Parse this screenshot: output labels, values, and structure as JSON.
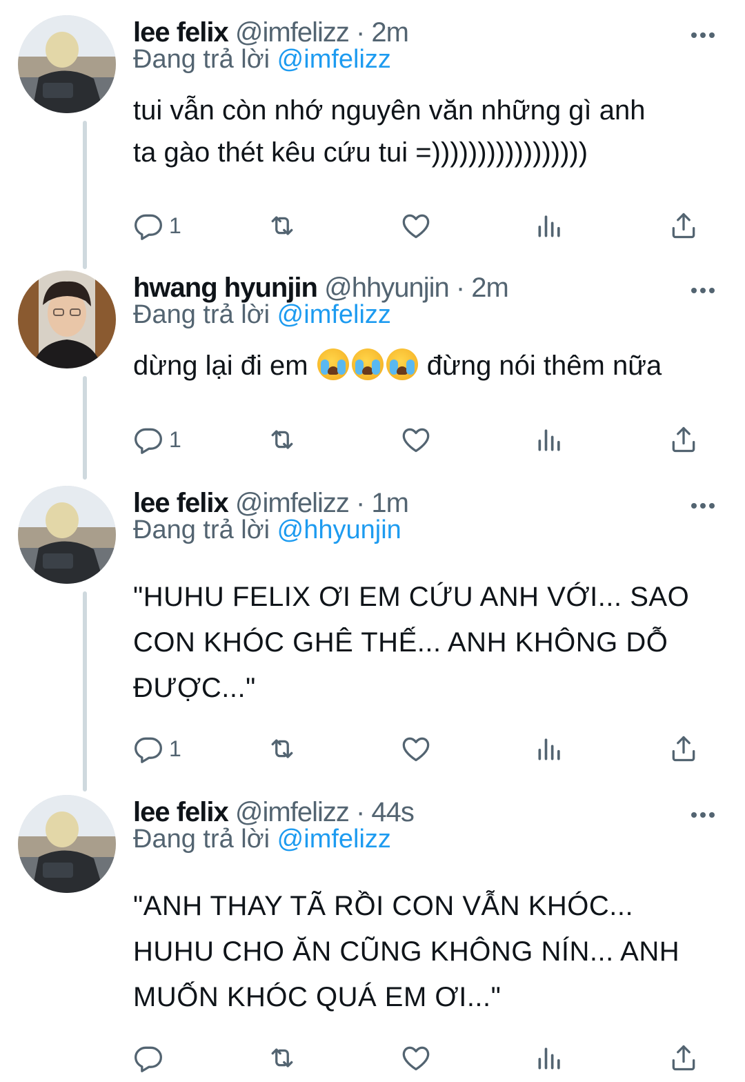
{
  "colors": {
    "accent": "#1d9bf0",
    "secondary_text": "#536471",
    "thread_line": "#cfd9de"
  },
  "tweets": [
    {
      "name": "lee felix",
      "handle": "@imfelizz",
      "dot": " · ",
      "time": "2m",
      "replying_prefix": "Đang trả lời ",
      "replying_to": "@imfelizz",
      "text_line1": "tui vẫn còn nhớ nguyên văn những gì anh",
      "text_line2": "ta gào thét kêu cứu tui =)))))))))))))))))",
      "reply_count": "1",
      "avatar_icon": "profile-photo"
    },
    {
      "name": "hwang hyunjin",
      "handle": "@hhyunjin",
      "dot": " · ",
      "time": "2m",
      "replying_prefix": "Đang trả lời ",
      "replying_to": "@imfelizz",
      "text_before_emoji": "dừng lại đi em ",
      "emoji": "loudly-crying-face",
      "text_after_emoji": " đừng nói thêm nữa",
      "reply_count": "1",
      "avatar_icon": "profile-photo"
    },
    {
      "name": "lee felix",
      "handle": "@imfelizz",
      "dot": " · ",
      "time": "1m",
      "replying_prefix": "Đang trả lời ",
      "replying_to": "@hhyunjin",
      "text_line1": "\"HUHU FELIX ƠI EM CỨU ANH VỚI... SAO",
      "text_line2": "CON KHÓC GHÊ THẾ... ANH KHÔNG DỖ",
      "text_line3": "ĐƯỢC...\"",
      "reply_count": "1",
      "avatar_icon": "profile-photo"
    },
    {
      "name": "lee felix",
      "handle": "@imfelizz",
      "dot": " · ",
      "time": "44s",
      "replying_prefix": "Đang trả lời ",
      "replying_to": "@imfelizz",
      "text_line1": "\"ANH THAY TÃ RỒI CON VẪN KHÓC...",
      "text_line2": "HUHU CHO ĂN CŨNG KHÔNG NÍN... ANH",
      "text_line3": "MUỐN KHÓC QUÁ EM ƠI...\"",
      "reply_count": "",
      "avatar_icon": "profile-photo"
    }
  ],
  "actions": {
    "reply_icon": "reply-icon",
    "retweet_icon": "retweet-icon",
    "like_icon": "like-icon",
    "views_icon": "analytics-icon",
    "share_icon": "share-icon",
    "more_icon": "more-icon"
  }
}
